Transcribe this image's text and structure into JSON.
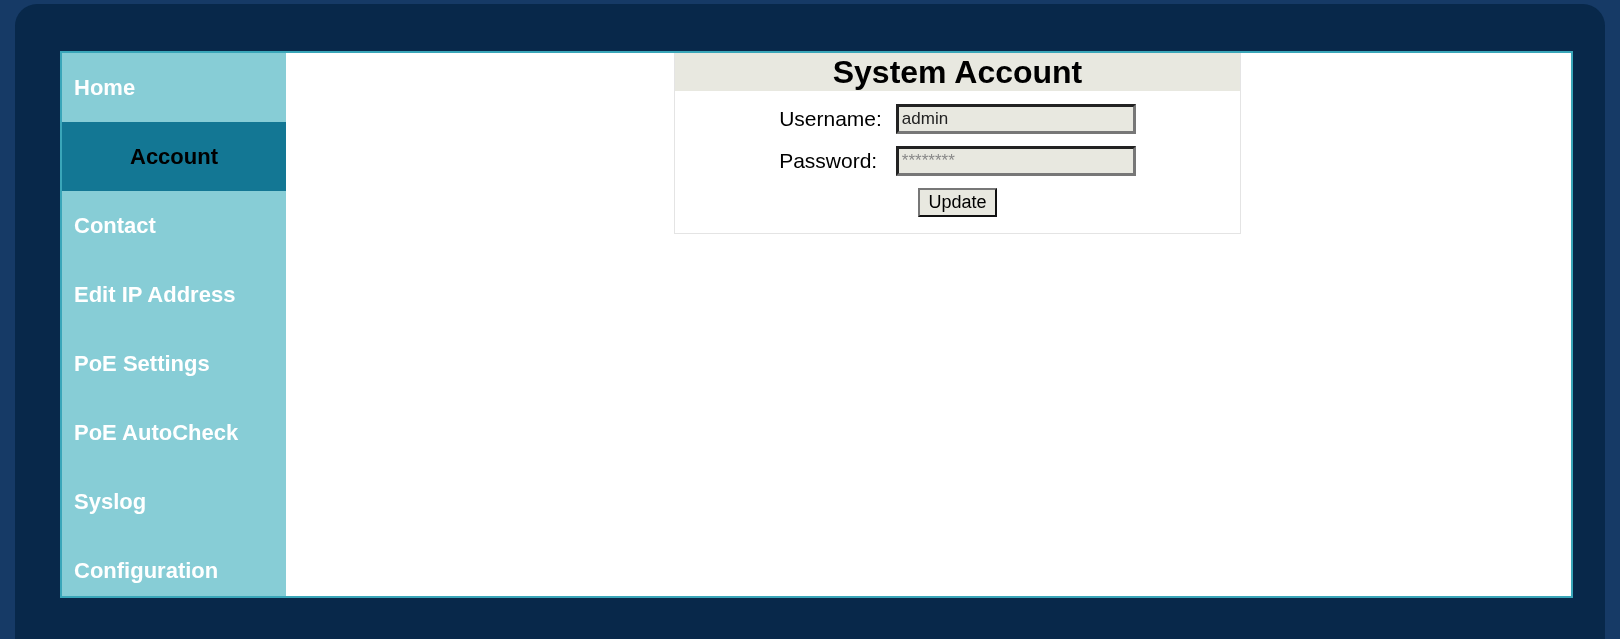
{
  "sidebar": {
    "items": [
      {
        "label": "Home",
        "selected": false
      },
      {
        "label": "Account",
        "selected": true
      },
      {
        "label": "Contact",
        "selected": false
      },
      {
        "label": "Edit IP Address",
        "selected": false
      },
      {
        "label": "PoE Settings",
        "selected": false
      },
      {
        "label": "PoE AutoCheck",
        "selected": false
      },
      {
        "label": "Syslog",
        "selected": false
      },
      {
        "label": "Configuration",
        "selected": false
      }
    ]
  },
  "form": {
    "title": "System Account",
    "fields": [
      {
        "label": "Username:",
        "value": "admin"
      },
      {
        "label": "Password:",
        "placeholder": "********"
      }
    ],
    "button": "Update"
  }
}
